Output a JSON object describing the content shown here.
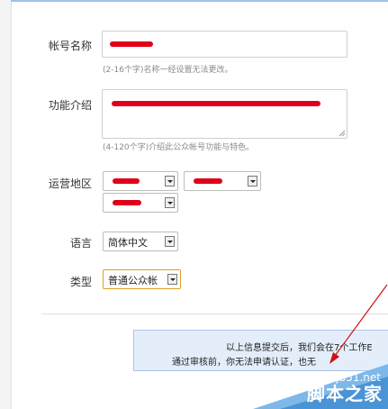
{
  "form": {
    "account_name": {
      "label": "帐号名称",
      "hint": "(2-16个字)名称一经设置无法更改。"
    },
    "description": {
      "label": "功能介绍",
      "hint": "(4-120个字)介绍此公众帐号功能与特色。"
    },
    "region": {
      "label": "运营地区"
    },
    "language": {
      "label": "语言",
      "selected": "简体中文"
    },
    "type": {
      "label": "类型",
      "selected": "普通公众帐"
    }
  },
  "notice": {
    "line1": "以上信息提交后，我们会在7个工作E",
    "line2": "通过审核前，你无法申请认证，也无"
  },
  "watermark": {
    "site": "jb51.net",
    "name": "脚本之家"
  },
  "colors": {
    "redaction": "#e0001a",
    "arrow": "#d01010",
    "notice_bg": "#e4eefb"
  }
}
